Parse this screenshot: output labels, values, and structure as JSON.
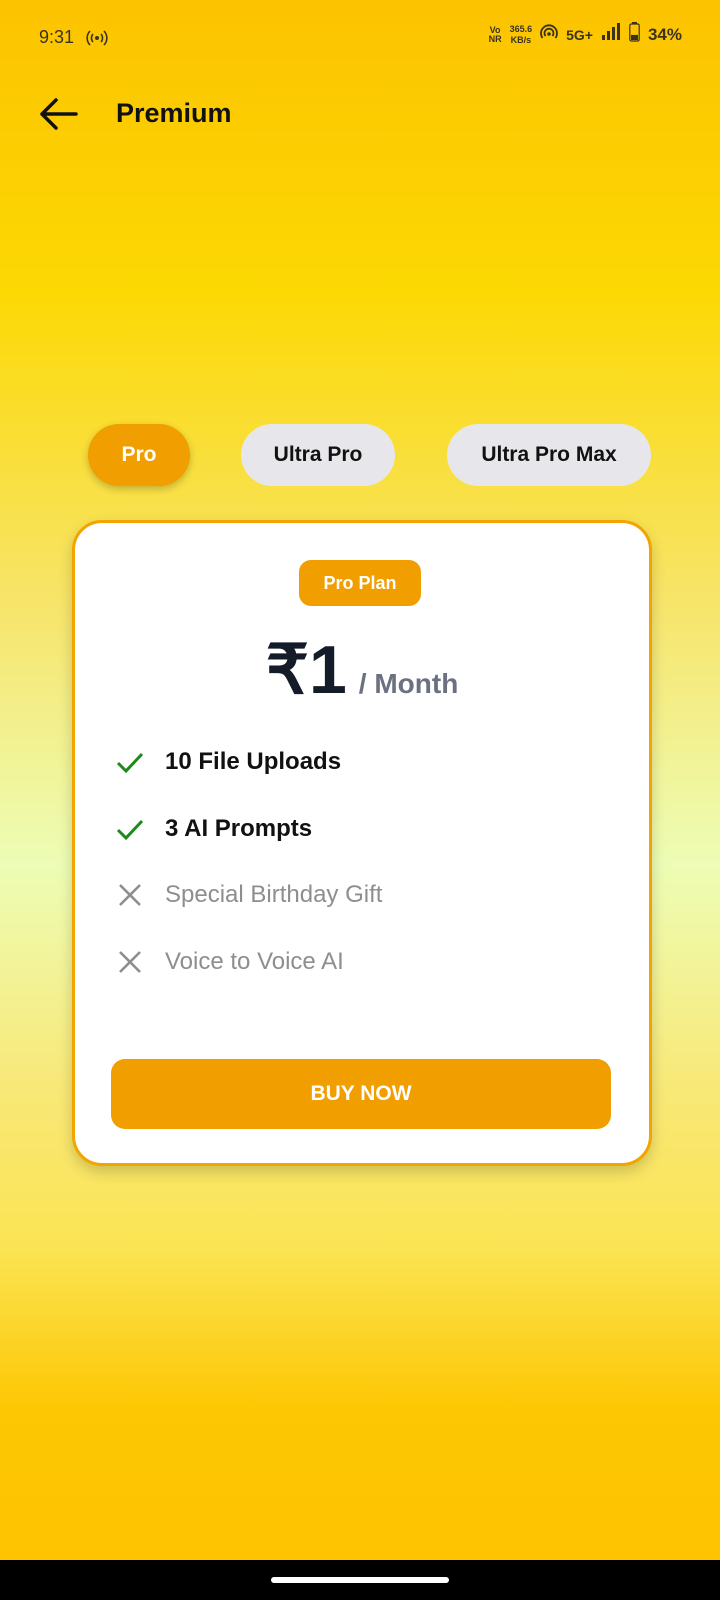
{
  "status_bar": {
    "time": "9:31",
    "vonr_top": "Vo",
    "vonr_bottom": "NR",
    "speed_value": "365.6",
    "speed_unit": "KB/s",
    "network": "5G+",
    "battery": "34%",
    "battery_level": 0.34
  },
  "header": {
    "title": "Premium"
  },
  "tabs": [
    {
      "label": "Pro",
      "selected": true
    },
    {
      "label": "Ultra Pro",
      "selected": false
    },
    {
      "label": "Ultra Pro Max",
      "selected": false
    }
  ],
  "plan": {
    "badge": "Pro Plan",
    "price": "₹1",
    "period": "/ Month",
    "features": [
      {
        "label": "10 File Uploads",
        "included": true
      },
      {
        "label": "3 AI Prompts",
        "included": true
      },
      {
        "label": "Special Birthday Gift",
        "included": false
      },
      {
        "label": "Voice to Voice AI",
        "included": false
      }
    ],
    "cta": "BUY NOW"
  },
  "colors": {
    "accent": "#F19E00",
    "check": "#1E8A1E",
    "cross": "#8E8E8E",
    "inactive_tab": "#E7E7EB"
  }
}
